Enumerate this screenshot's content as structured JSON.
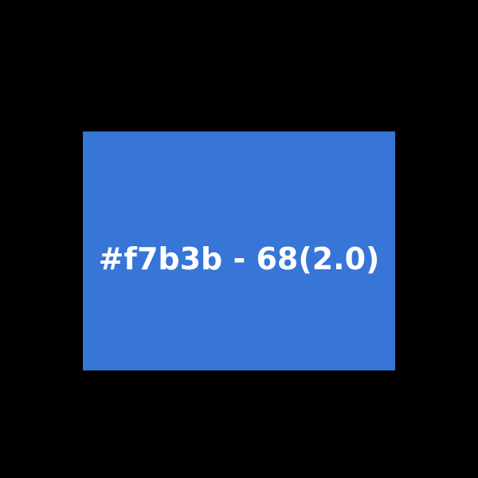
{
  "colors": {
    "background": "#000000",
    "panel": "#3775d6",
    "text": "#ffffff"
  },
  "panel": {
    "label": "#f7b3b - 68(2.0)"
  }
}
